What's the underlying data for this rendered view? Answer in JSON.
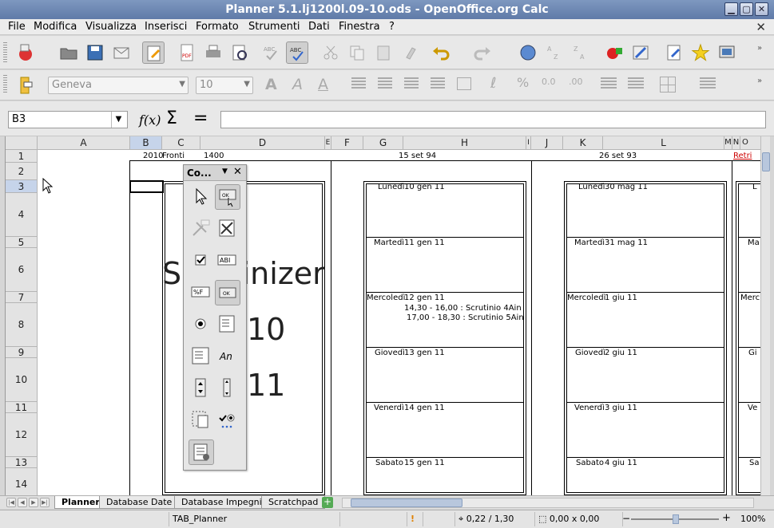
{
  "window": {
    "title": "Planner 5.1.lj1200l.09-10.ods - OpenOffice.org Calc"
  },
  "menu": {
    "items": [
      "File",
      "Modifica",
      "Visualizza",
      "Inserisci",
      "Formato",
      "Strumenti",
      "Dati",
      "Finestra",
      "?"
    ]
  },
  "format_toolbar": {
    "font_name": "Geneva",
    "font_size": "10"
  },
  "formula_bar": {
    "name_box": "B3",
    "fx_label": "f(x)",
    "sum_label": "Σ",
    "equals_label": "=",
    "formula": ""
  },
  "grid": {
    "columns": [
      "A",
      "B",
      "C",
      "D",
      "E",
      "F",
      "G",
      "H",
      "I",
      "J",
      "K",
      "L",
      "M",
      "N",
      "O"
    ],
    "selected_column": "B",
    "rows": [
      "1",
      "2",
      "3",
      "4",
      "5",
      "6",
      "7",
      "8",
      "9",
      "10",
      "11",
      "12",
      "13",
      "14"
    ],
    "selected_row": "3"
  },
  "row1": {
    "b1": "2010",
    "c1": "Fronti",
    "c1b": "1400",
    "g1": "15 set 94",
    "k1": "26 set 93",
    "n1": "Retri"
  },
  "front_page": {
    "title": "Scrutinizer",
    "year1": "10",
    "year2": "11"
  },
  "week1": [
    {
      "day": "Lunedì",
      "date": "10 gen 11",
      "notes": []
    },
    {
      "day": "Martedì",
      "date": "11 gen 11",
      "notes": []
    },
    {
      "day": "Mercoledì",
      "date": "12 gen 11",
      "notes": [
        "14,30 - 16,00 : Scrutinio 4Ain",
        "17,00 - 18,30 : Scrutinio 5Ain"
      ]
    },
    {
      "day": "Giovedì",
      "date": "13 gen 11",
      "notes": []
    },
    {
      "day": "Venerdì",
      "date": "14 gen 11",
      "notes": []
    },
    {
      "day": "Sabato",
      "date": "15 gen 11",
      "notes": []
    }
  ],
  "week2": [
    {
      "day": "Lunedì",
      "date": "30 mag 11"
    },
    {
      "day": "Martedì",
      "date": "31 mag 11"
    },
    {
      "day": "Mercoledì",
      "date": "1 giu 11"
    },
    {
      "day": "Giovedì",
      "date": "2 giu 11"
    },
    {
      "day": "Venerdì",
      "date": "3 giu 11"
    },
    {
      "day": "Sabato",
      "date": "4 giu 11"
    }
  ],
  "week3_partial": [
    "L",
    "Ma",
    "Merc",
    "Gi",
    "Ve",
    "Sa"
  ],
  "controls_panel": {
    "title": "Co..."
  },
  "sheet_tabs": {
    "tabs": [
      "Planner",
      "Database Date",
      "Database Impegni",
      "Scratchpad"
    ],
    "active": "Planner"
  },
  "status": {
    "sheet_name": "TAB_Planner",
    "position": "0,22 / 1,30",
    "size": "0,00 x 0,00",
    "zoom": "100%"
  },
  "colors": {
    "title_bar": "#6a84b2",
    "selection": "#c6d4ea"
  }
}
